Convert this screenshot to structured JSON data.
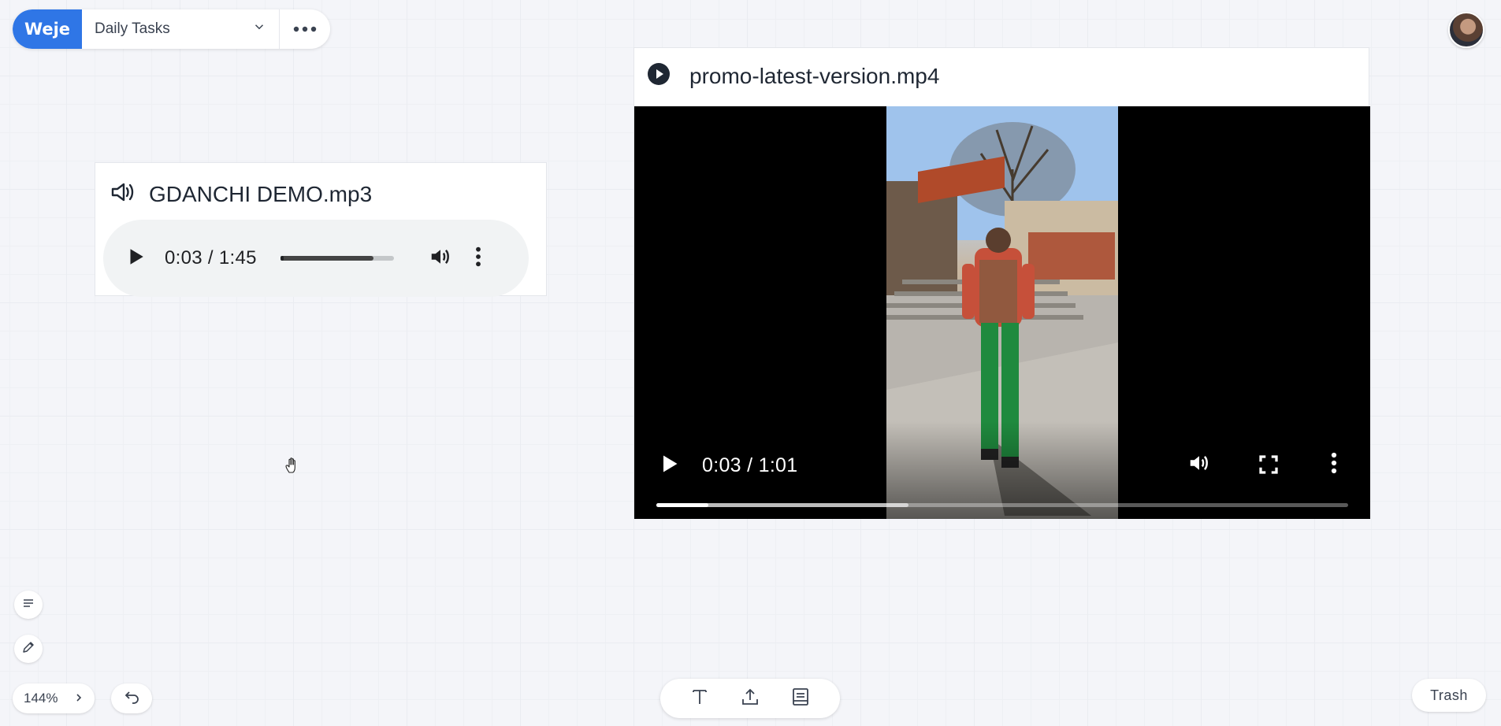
{
  "app": {
    "logo_text": "Weje"
  },
  "board": {
    "name": "Daily Tasks"
  },
  "audio": {
    "filename": "GDANCHI DEMO.mp3",
    "current_time": "0:03",
    "duration": "1:45",
    "time_separator": " / ",
    "progress": 0.03,
    "buffered": 0.82
  },
  "video": {
    "filename": "promo-latest-version.mp4",
    "current_time": "0:03",
    "duration": "1:01",
    "time_separator": " / ",
    "progress": 0.075,
    "buffered": 0.365
  },
  "zoom": {
    "level": "144%"
  },
  "trash": {
    "label": "Trash"
  },
  "colors": {
    "brand": "#2f76e6",
    "canvas": "#f4f5f9"
  }
}
